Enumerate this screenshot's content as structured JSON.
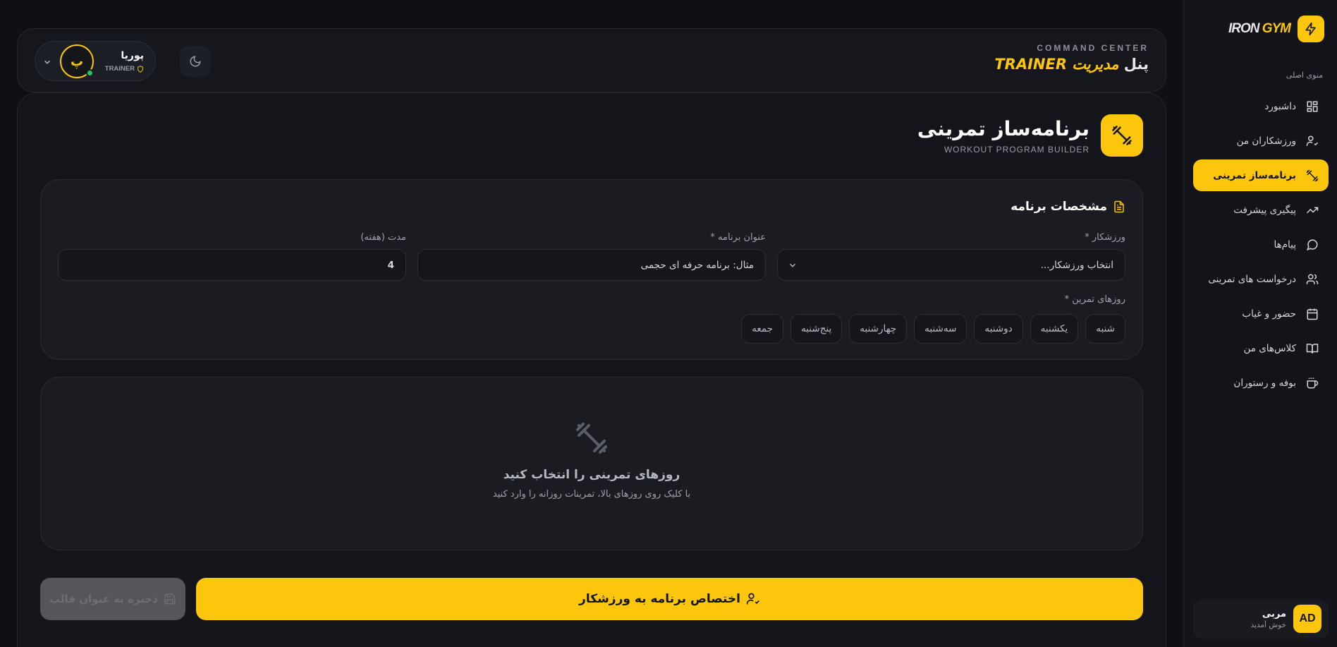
{
  "brand": {
    "part1": "IRON",
    "part2": "GYM"
  },
  "sidebar": {
    "menu_title": "منوی اصلی",
    "items": [
      {
        "label": "داشبورد",
        "icon": "grid-icon"
      },
      {
        "label": "ورزشکاران من",
        "icon": "user-check-icon"
      },
      {
        "label": "برنامه‌ساز تمرینی",
        "icon": "dumbbell-icon",
        "active": true
      },
      {
        "label": "پیگیری پیشرفت",
        "icon": "trending-up-icon"
      },
      {
        "label": "پیام‌ها",
        "icon": "message-circle-icon"
      },
      {
        "label": "درخواست های تمرینی",
        "icon": "users-icon"
      },
      {
        "label": "حضور و غیاب",
        "icon": "calendar-icon"
      },
      {
        "label": "کلاس‌های من",
        "icon": "book-open-icon"
      },
      {
        "label": "بوفه و رستوران",
        "icon": "coffee-icon"
      }
    ],
    "user": {
      "initials": "AD",
      "name": "مربی",
      "subtitle": "خوش آمدید"
    }
  },
  "header": {
    "eyebrow": "COMMAND CENTER",
    "title_prefix": "پنل",
    "title_highlight": "مدیریت TRAINER",
    "profile": {
      "initial": "پ",
      "name": "پوریا",
      "role": "TRAINER"
    }
  },
  "page": {
    "title": "برنامه‌ساز تمرینی",
    "subtitle": "WORKOUT PROGRAM BUILDER"
  },
  "specs": {
    "title": "مشخصات برنامه",
    "athlete_label": "ورزشکار *",
    "athlete_value": "انتخاب ورزشکار...",
    "program_title_label": "عنوان برنامه *",
    "program_title_placeholder": "مثال: برنامه حرفه ای حجمی",
    "duration_label": "مدت (هفته)",
    "duration_value": "4",
    "days_label": "روزهای تمرین *",
    "days": [
      "شنبه",
      "یکشنبه",
      "دوشنبه",
      "سه‌شنبه",
      "چهارشنبه",
      "پنج‌شنبه",
      "جمعه"
    ]
  },
  "empty_state": {
    "title": "روزهای تمرینی را انتخاب کنید",
    "subtitle": "با کلیک روی روزهای بالا، تمرینات روزانه را وارد کنید"
  },
  "actions": {
    "assign_label": "اختصاص برنامه به ورزشکار",
    "template_label": "ذخیره به عنوان قالب"
  },
  "colors": {
    "accent": "#fcc60c",
    "background": "#0f1014",
    "online": "#22c55e"
  }
}
